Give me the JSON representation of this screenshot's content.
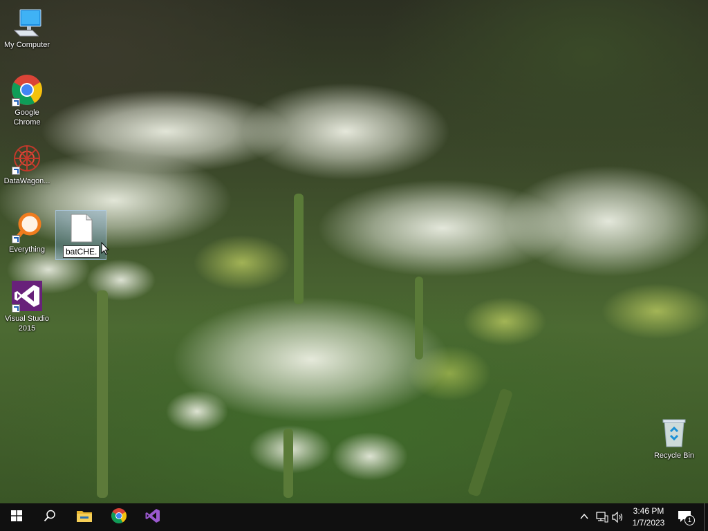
{
  "desktop": {
    "icons": [
      {
        "label": "My Computer",
        "icon": "computer-icon"
      },
      {
        "label": "Google Chrome",
        "icon": "chrome-icon"
      },
      {
        "label": "DataWagon...",
        "icon": "datawagon-icon"
      },
      {
        "label": "Everything",
        "icon": "everything-search-icon"
      },
      {
        "label": "Visual Studio 2015",
        "icon": "visual-studio-icon"
      },
      {
        "label": "Recycle Bin",
        "icon": "recycle-bin-icon"
      }
    ],
    "dragged_file": {
      "label": "batCHE.",
      "icon": "file-icon"
    }
  },
  "taskbar": {
    "start": "windows-start-icon",
    "search": "search-icon",
    "pinned": [
      {
        "name": "File Explorer",
        "icon": "folder-icon"
      },
      {
        "name": "Google Chrome",
        "icon": "chrome-icon"
      },
      {
        "name": "Visual Studio",
        "icon": "visual-studio-icon"
      }
    ],
    "tray": {
      "chevron": "chevron-up-icon",
      "network": "network-icon",
      "volume": "volume-icon",
      "time": "3:46 PM",
      "date": "1/7/2023",
      "notifications_count": "1"
    }
  },
  "colors": {
    "taskbar": "#101010",
    "accent": "#76b9ed",
    "vs_purple": "#68217a"
  }
}
